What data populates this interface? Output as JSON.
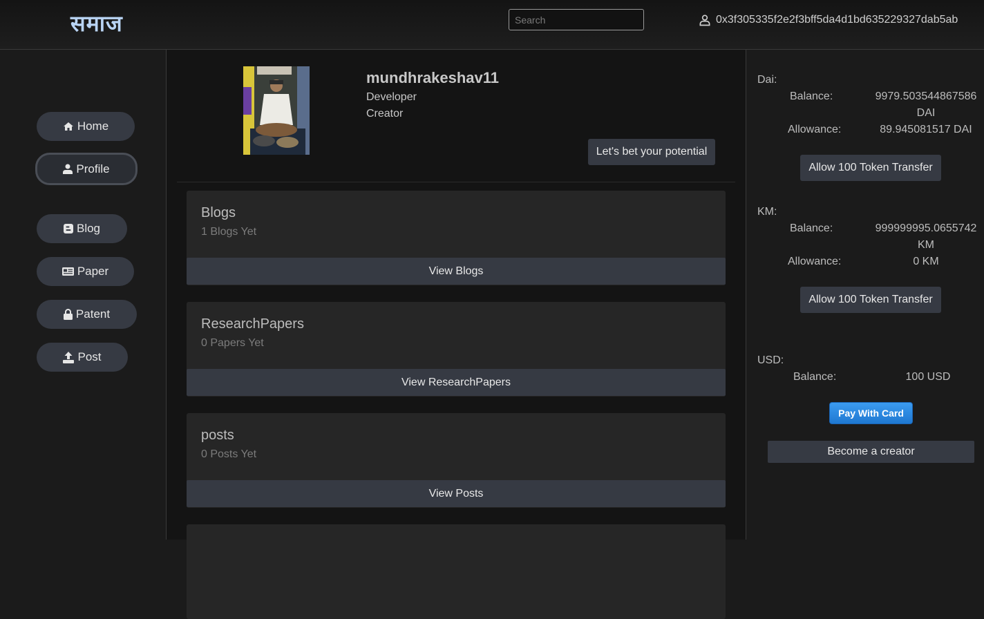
{
  "header": {
    "logo": "समाज",
    "search_placeholder": "Search",
    "account_address": "0x3f305335f2e2f3bff5da4d1bd635229327dab5ab"
  },
  "sidebar": {
    "items": [
      {
        "label": "Home",
        "icon": "home-icon"
      },
      {
        "label": "Profile",
        "icon": "user-icon",
        "active": true
      },
      {
        "label": "Blog",
        "icon": "blogger-icon"
      },
      {
        "label": "Paper",
        "icon": "newspaper-icon"
      },
      {
        "label": "Patent",
        "icon": "lock-icon"
      },
      {
        "label": "Post",
        "icon": "upload-icon"
      }
    ]
  },
  "profile": {
    "username": "mundhrakeshav11",
    "roles": [
      "Developer",
      "Creator"
    ],
    "bet_button": "Let's bet your potential"
  },
  "cards": [
    {
      "title": "Blogs",
      "subtitle": "1 Blogs Yet",
      "button": "View Blogs"
    },
    {
      "title": "ResearchPapers",
      "subtitle": "0 Papers Yet",
      "button": "View ResearchPapers"
    },
    {
      "title": "posts",
      "subtitle": "0 Posts Yet",
      "button": "View Posts"
    }
  ],
  "tokens": {
    "dai": {
      "name": "Dai:",
      "balance_label": "Balance:",
      "balance_value": "9979.503544867586",
      "balance_unit": "DAI",
      "allowance_label": "Allowance:",
      "allowance_value": "89.945081517 DAI",
      "button": "Allow 100 Token Transfer"
    },
    "km": {
      "name": "KM:",
      "balance_label": "Balance:",
      "balance_value": "999999995.0655742",
      "balance_unit": "KM",
      "allowance_label": "Allowance:",
      "allowance_value": "0 KM",
      "button": "Allow 100 Token Transfer"
    },
    "usd": {
      "name": "USD:",
      "balance_label": "Balance:",
      "balance_value": "100 USD",
      "pay_button": "Pay With Card"
    }
  },
  "become_creator": "Become a creator",
  "colors": {
    "logo": "#b9d4f4",
    "button": "#363a43",
    "pay_button": "#2586e0",
    "background": "#1b1b1b"
  }
}
